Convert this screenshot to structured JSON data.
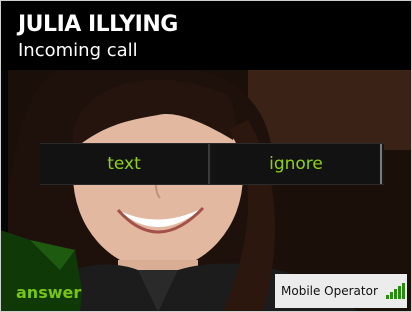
{
  "caller": {
    "name": "JULIA ILLYING",
    "status": "Incoming call"
  },
  "actions": {
    "text_label": "text",
    "ignore_label": "ignore",
    "answer_label": "answer"
  },
  "status_bar": {
    "operator": "Mobile Operator",
    "signal_icon": "signal-strength-icon",
    "signal_level": 1.0
  },
  "colors": {
    "accent": "#8fd11a",
    "answer": "#77c414",
    "background": "#000000"
  }
}
